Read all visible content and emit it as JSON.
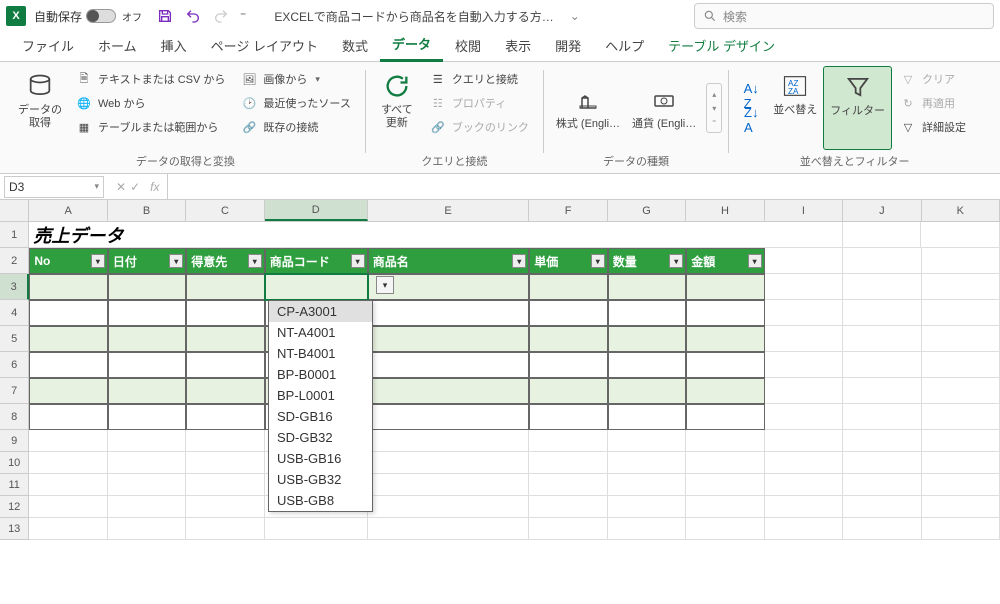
{
  "titlebar": {
    "autosave_label": "自動保存",
    "toggle_state": "オフ",
    "document_title": "EXCELで商品コードから商品名を自動入力する方…",
    "search_placeholder": "検索"
  },
  "tabs": {
    "file": "ファイル",
    "home": "ホーム",
    "insert": "挿入",
    "page_layout": "ページ レイアウト",
    "formulas": "数式",
    "data": "データ",
    "review": "校閲",
    "view": "表示",
    "developer": "開発",
    "help": "ヘルプ",
    "table_design": "テーブル デザイン"
  },
  "ribbon": {
    "get_data": {
      "label": "データの\n取得",
      "group": "データの取得と変換"
    },
    "from_text_csv": "テキストまたは CSV から",
    "from_web": "Web から",
    "from_table": "テーブルまたは範囲から",
    "from_picture": "画像から",
    "recent_sources": "最近使ったソース",
    "existing_conn": "既存の接続",
    "refresh_all": {
      "label": "すべて\n更新",
      "group": "クエリと接続"
    },
    "queries_conn": "クエリと接続",
    "properties": "プロパティ",
    "workbook_links": "ブックのリンク",
    "stocks": "株式 (Engli…",
    "currencies": "通貨 (Engli…",
    "data_types_group": "データの種類",
    "sort": "並べ替え",
    "filter": "フィルター",
    "clear": "クリア",
    "reapply": "再適用",
    "advanced": "詳細設定",
    "sort_filter_group": "並べ替えとフィルター"
  },
  "formula_bar": {
    "name_box": "D3"
  },
  "grid": {
    "columns": [
      "A",
      "B",
      "C",
      "D",
      "E",
      "F",
      "G",
      "H",
      "I",
      "J",
      "K"
    ],
    "title": "売上データ",
    "headers": {
      "no": "No",
      "date": "日付",
      "customer": "得意先",
      "product_code": "商品コード",
      "product_name": "商品名",
      "unit_price": "単価",
      "qty": "数量",
      "amount": "金額"
    },
    "dropdown_items": [
      "CP-A3001",
      "NT-A4001",
      "NT-B4001",
      "BP-B0001",
      "BP-L0001",
      "SD-GB16",
      "SD-GB32",
      "USB-GB16",
      "USB-GB32",
      "USB-GB8"
    ],
    "row_numbers": [
      1,
      2,
      3,
      4,
      5,
      6,
      7,
      8,
      9,
      10,
      11,
      12,
      13
    ]
  }
}
